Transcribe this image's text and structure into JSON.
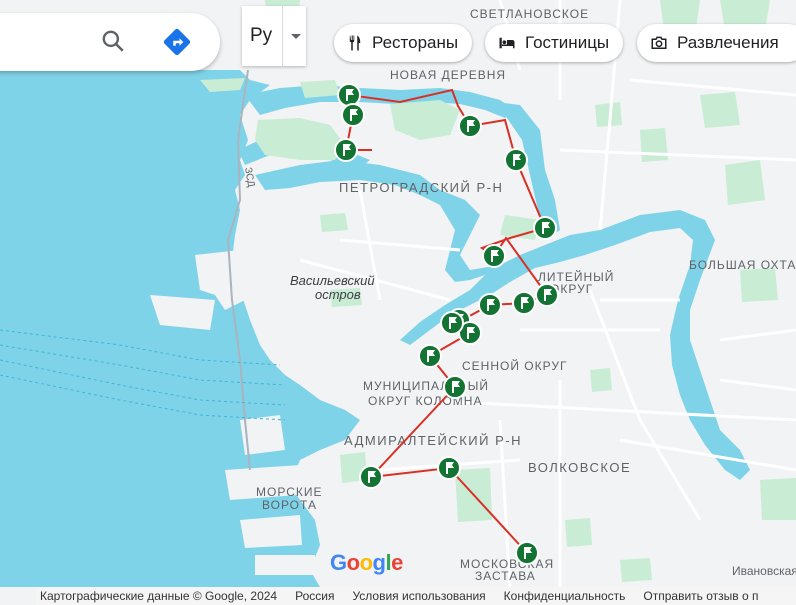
{
  "search": {
    "placeholder": ""
  },
  "language": {
    "value": "Ру"
  },
  "chips": [
    {
      "label": "Рестораны",
      "icon": "fork-knife-icon"
    },
    {
      "label": "Гостиницы",
      "icon": "bed-icon"
    },
    {
      "label": "Развлечения",
      "icon": "camera-icon"
    }
  ],
  "labels": {
    "svetlanovskoe": "СВЕТЛАНОВСКОЕ",
    "novaya_derevnya": "НОВАЯ ДЕРЕВНЯ",
    "petrogradsky": "ПЕТРОГРАДСКИЙ Р-Н",
    "vasilievsky_1": "Васильевский",
    "vasilievsky_2": "остров",
    "liteyny_1": "ЛИТЕЙНЫЙ",
    "liteyny_2": "ОКРУГ",
    "bolshaya_okhta": "БОЛЬШАЯ ОХТА",
    "sennoy": "СЕННОЙ ОКРУГ",
    "kolomna_1": "МУНИЦИПАЛЬНЫЙ",
    "kolomna_2": "ОКРУГ КОЛОМНА",
    "admiralteysky": "АДМИРАЛТЕЙСКИЙ Р-Н",
    "volkovskoe": "ВОЛКОВСКОЕ",
    "morskie_1": "МОРСКИЕ",
    "morskie_2": "ВОРОТА",
    "moskovskaya_1": "МОСКОВСКАЯ",
    "moskovskaya_2": "ЗАСТАВА",
    "ivanovskaya": "Ивановская",
    "zsd": "ЗСД"
  },
  "google_logo": "Google",
  "footer": {
    "map_data": "Картографические данные © Google, 2024",
    "country": "Россия",
    "terms": "Условия использования",
    "privacy": "Конфиденциальность",
    "feedback": "Отправить отзыв о п"
  },
  "route": {
    "line_color": "#d93025",
    "marker_color": "#137333",
    "marker_count": 18
  },
  "colors": {
    "water": "#7fd3e9",
    "land": "#f1f3f4",
    "park": "#c9ecd4"
  }
}
